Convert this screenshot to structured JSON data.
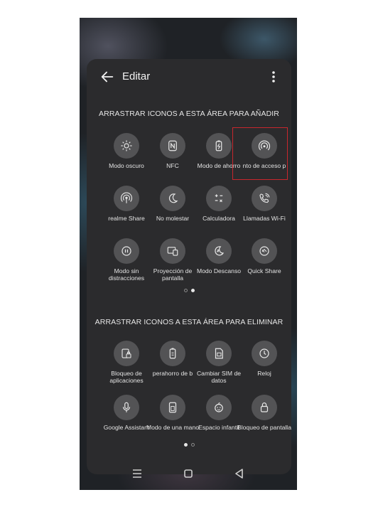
{
  "header": {
    "title": "Editar",
    "back_icon": "arrow-left-icon",
    "more_icon": "more-vertical-icon"
  },
  "add_section": {
    "title": "ARRASTRAR ICONOS A ESTA ÁREA PARA AÑADIR",
    "tiles": [
      {
        "label": "Modo oscuro",
        "icon": "brightness-icon"
      },
      {
        "label": "NFC",
        "icon": "nfc-icon"
      },
      {
        "label": "Modo de ahorro",
        "icon": "battery-icon"
      },
      {
        "label": "nto de acceso p",
        "icon": "hotspot-icon"
      },
      {
        "label": "realme Share",
        "icon": "share-signal-icon"
      },
      {
        "label": "No molestar",
        "icon": "moon-icon"
      },
      {
        "label": "Calculadora",
        "icon": "calculator-icon"
      },
      {
        "label": "Llamadas Wi-Fi",
        "icon": "wifi-call-icon"
      },
      {
        "label": "Modo sin distracciones",
        "icon": "focus-icon"
      },
      {
        "label": "Proyección de pantalla",
        "icon": "screen-cast-icon"
      },
      {
        "label": "Modo Descanso",
        "icon": "rest-moon-icon"
      },
      {
        "label": "Quick Share",
        "icon": "quick-share-icon"
      }
    ],
    "pages": 2,
    "active_page": 2
  },
  "remove_section": {
    "title": "ARRASTRAR ICONOS A ESTA ÁREA PARA ELIMINAR",
    "tiles": [
      {
        "label": "Bloqueo de aplicaciones",
        "icon": "app-lock-icon"
      },
      {
        "label": "perahorro de b",
        "icon": "super-battery-icon"
      },
      {
        "label": "Cambiar SIM de datos",
        "icon": "sim-icon"
      },
      {
        "label": "Reloj",
        "icon": "clock-icon"
      },
      {
        "label": "Google Assistant",
        "icon": "mic-icon"
      },
      {
        "label": "Modo de una mano",
        "icon": "one-hand-icon"
      },
      {
        "label": "Espacio infantil",
        "icon": "kid-face-icon"
      },
      {
        "label": "Bloqueo de pantalla",
        "icon": "lock-icon"
      }
    ],
    "pages": 2,
    "active_page": 1
  },
  "navbar": {
    "menu_icon": "menu-icon",
    "home_icon": "home-square-icon",
    "back_icon": "triangle-back-icon"
  },
  "colors": {
    "panel": "#2b2b2d",
    "tile_circle": "#535355",
    "highlight": "#c8272d"
  }
}
